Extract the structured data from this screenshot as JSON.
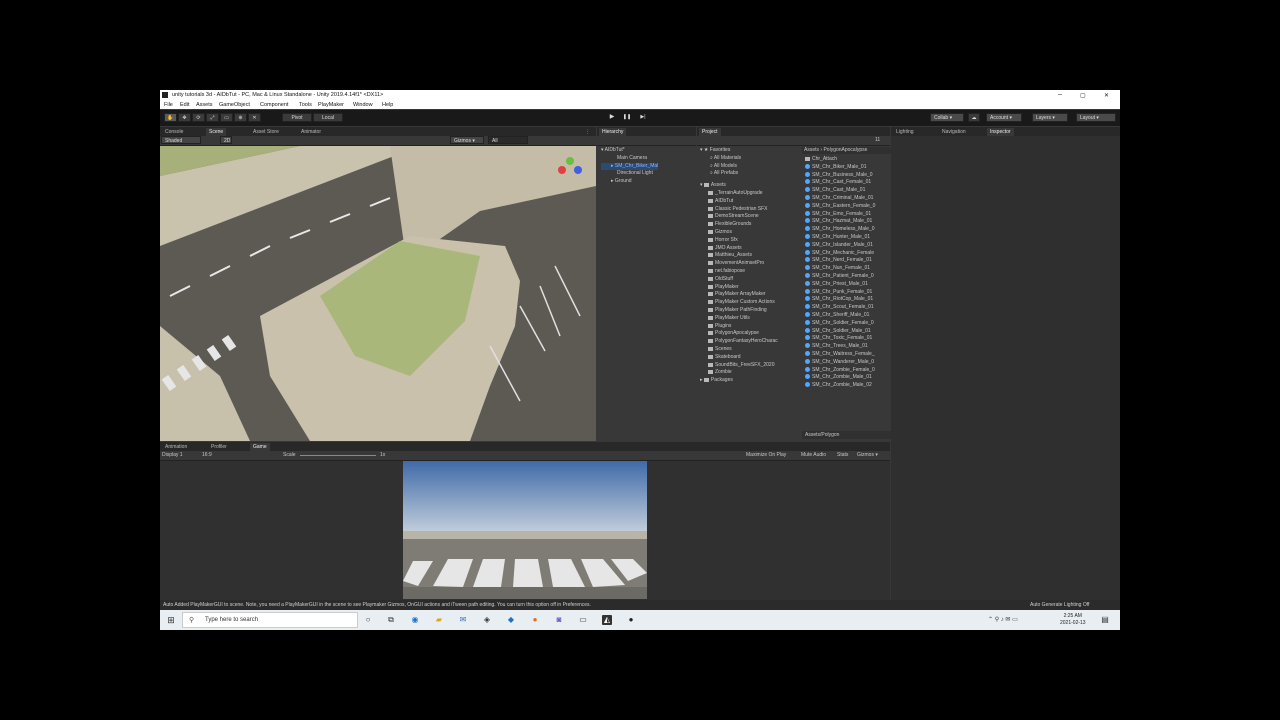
{
  "window": {
    "title": "unity tutorials 3d - AIDbTut - PC, Mac & Linux Standalone - Unity 2019.4.14f1* <DX11>",
    "min": "–",
    "max": "▢",
    "close": "✕"
  },
  "menu": [
    "File",
    "Edit",
    "Assets",
    "GameObject",
    "Component",
    "Tools",
    "PlayMaker",
    "Window",
    "Help"
  ],
  "toolbar": {
    "pivot": "Pivot",
    "local": "Local",
    "play": "▶",
    "pause": "❚❚",
    "step": "▶|",
    "collab": "Collab ▾",
    "account": "Account ▾",
    "layers": "Layers ▾",
    "layout": "Layout ▾"
  },
  "scene_tabs": [
    "Console",
    "Scene",
    "Asset Store",
    "Animator"
  ],
  "scene_bar": {
    "shading": "Shaded",
    "mode": "2D",
    "gizmos": "Gizmos ▾",
    "search": "All"
  },
  "hierarchy": {
    "tab": "Hierarchy",
    "items": [
      "AIDbTut*",
      "Main Camera",
      "SM_Chr_Biker_Mal",
      "Directional Light",
      "Ground"
    ]
  },
  "project": {
    "tab": "Project",
    "favorites": {
      "label": "Favorites",
      "items": [
        "All Materials",
        "All Models",
        "All Prefabs"
      ]
    },
    "assets": {
      "label": "Assets",
      "items": [
        "_TerrainAutoUpgrade",
        "AIDbTut",
        "Classic Pedestrian SFX",
        "DemoStreamScene",
        "FlexibleGrounds",
        "Gizmos",
        "Horror Sfx",
        "JMO Assets",
        "Matthieu_Assets",
        "MovementAnimsetPro",
        "net.fabiopose",
        "OldStuff",
        "PlayMaker",
        "PlayMaker ArrayMaker",
        "PlayMaker Custom Actions",
        "PlayMaker PathFinding",
        "PlayMaker Utils",
        "Plugins",
        "PolygonApocalypse",
        "PolygonFantasyHeroCharac",
        "Scenes",
        "Skateboard",
        "SoundBits_FreeSFX_2020",
        "Zombie"
      ]
    },
    "packages": "Packages",
    "breadcrumb": [
      "Assets",
      "PolygonApocalypse"
    ],
    "files": [
      "Chr_Attach",
      "SM_Chr_Biker_Male_01",
      "SM_Chr_Business_Male_0",
      "SM_Chr_Cast_Female_01",
      "SM_Chr_Cast_Male_01",
      "SM_Chr_Criminal_Male_01",
      "SM_Chr_Eastern_Female_0",
      "SM_Chr_Emo_Female_01",
      "SM_Chr_Hazmat_Male_01",
      "SM_Chr_Homeless_Male_0",
      "SM_Chr_Hunter_Male_01",
      "SM_Chr_Islander_Male_01",
      "SM_Chr_Mechanic_Female",
      "SM_Chr_Nerd_Female_01",
      "SM_Chr_Nun_Female_01",
      "SM_Chr_Patient_Female_0",
      "SM_Chr_Priest_Male_01",
      "SM_Chr_Punk_Female_01",
      "SM_Chr_RiotCop_Male_01",
      "SM_Chr_Scout_Female_01",
      "SM_Chr_Sheriff_Male_01",
      "SM_Chr_Soldier_Female_0",
      "SM_Chr_Soldier_Male_01",
      "SM_Chr_Toxic_Female_01",
      "SM_Chr_Trees_Male_01",
      "SM_Chr_Waitress_Female_",
      "SM_Chr_Wanderer_Male_0",
      "SM_Chr_Zombie_Female_0",
      "SM_Chr_Zombie_Male_01",
      "SM_Chr_Zombie_Male_02"
    ],
    "footer": "Assets/Polygon",
    "badge": "11"
  },
  "right_tabs": [
    "Lighting",
    "Navigation",
    "Inspector"
  ],
  "bottom_tabs": [
    "Animation",
    "Profiler",
    "Game"
  ],
  "game_bar": {
    "display": "Display 1",
    "aspect": "16:9",
    "scale_label": "Scale",
    "scale_value": "1x",
    "maximize": "Maximize On Play",
    "mute": "Mute Audio",
    "stats": "Stats",
    "gizmos": "Gizmos ▾"
  },
  "status": {
    "message": "Auto Added PlayMakerGUI to scene. Note, you need a PlayMakerGUI in the scene to see Playmaker Gizmos, OnGUI actions and iTween path editing. You can turn this option off in Preferences.",
    "right": "Auto Generate Lighting Off"
  },
  "taskbar": {
    "search_placeholder": "Type here to search",
    "time": "2:25 AM",
    "date": "2021-02-13"
  },
  "colors": {
    "unity_dark": "#383838",
    "selection_blue": "#3a72b0",
    "hierarchy_highlight": "#8ab4ff"
  }
}
